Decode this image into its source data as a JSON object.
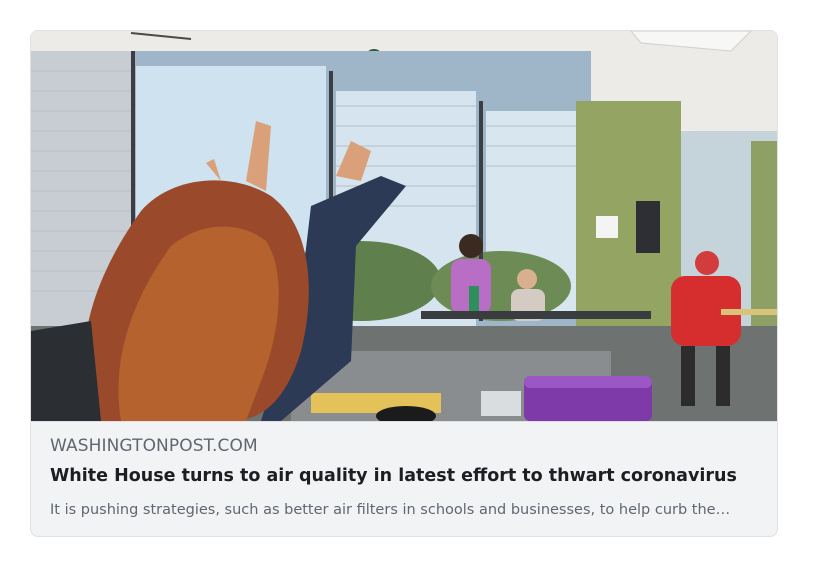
{
  "link_preview": {
    "domain": "WASHINGTONPOST.COM",
    "title": "White House turns to air quality in latest effort to thwart coronavirus",
    "description": "It is pushing strategies, such as better air filters in schools and businesses, to help curb the…",
    "image_subject": "classroom-students-raising-hands"
  }
}
